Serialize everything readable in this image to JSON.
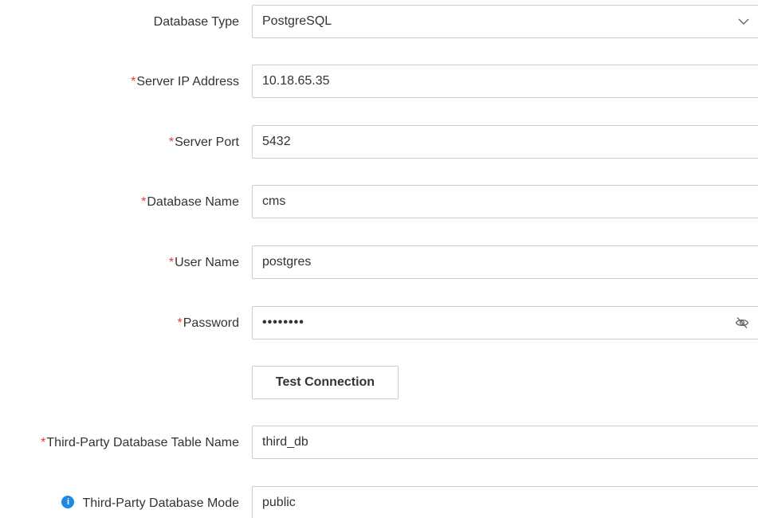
{
  "form": {
    "database_type": {
      "label": "Database Type",
      "required": false,
      "value": "PostgreSQL"
    },
    "server_ip": {
      "label": "Server IP Address",
      "required_mark": "*",
      "value": "10.18.65.35"
    },
    "server_port": {
      "label": "Server Port",
      "required_mark": "*",
      "value": "5432"
    },
    "database_name": {
      "label": "Database Name",
      "required_mark": "*",
      "value": "cms"
    },
    "user_name": {
      "label": "User Name",
      "required_mark": "*",
      "value": "postgres"
    },
    "password": {
      "label": "Password",
      "required_mark": "*",
      "masked_value": "••••••••"
    },
    "test_connection_label": "Test Connection",
    "third_party_table": {
      "label": "Third-Party Database Table Name",
      "required_mark": "*",
      "value": "third_db"
    },
    "third_party_mode": {
      "label": "Third-Party Database Mode",
      "info_icon_glyph": "i",
      "value": "public"
    }
  },
  "icons": {
    "dropdown": "chevron-down-icon",
    "password_toggle": "eye-off-icon",
    "info": "info-icon"
  },
  "colors": {
    "required": "#e4393c",
    "info": "#1e88e5",
    "border": "#c9cdd4",
    "text": "#333333"
  }
}
